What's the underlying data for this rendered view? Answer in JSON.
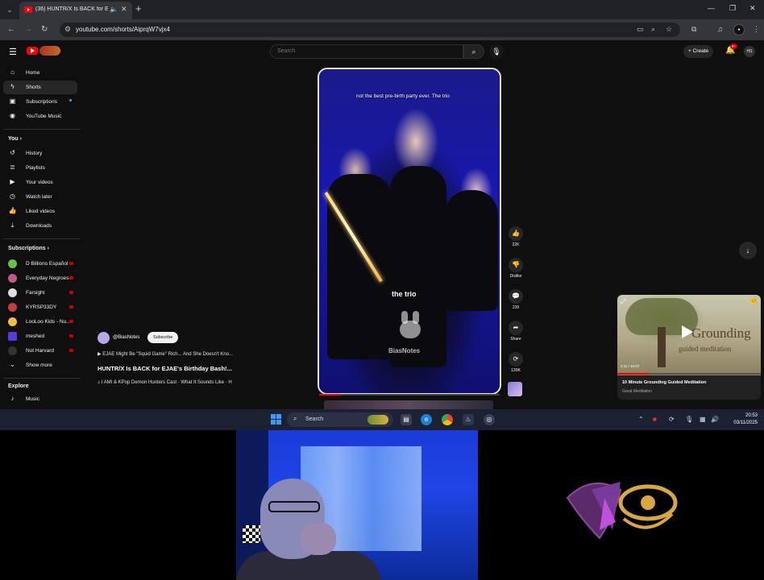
{
  "browser": {
    "tab_title": "(36) HUNTR/X Is BACK for EJAE",
    "url": "youtube.com/shorts/AiprqW7vjx4"
  },
  "youtube": {
    "search_placeholder": "Search",
    "create_label": "Create",
    "notification_count": "9+",
    "profile_initials": "HS"
  },
  "sidebar": {
    "main_items": [
      {
        "label": "Home",
        "icon": "home-icon"
      },
      {
        "label": "Shorts",
        "icon": "shorts-icon"
      },
      {
        "label": "Subscriptions",
        "icon": "subscriptions-icon"
      },
      {
        "label": "YouTube Music",
        "icon": "youtube-music-icon"
      }
    ],
    "you_heading": "You",
    "you_items": [
      {
        "label": "History",
        "icon": "history-icon"
      },
      {
        "label": "Playlists",
        "icon": "playlists-icon"
      },
      {
        "label": "Your videos",
        "icon": "your-videos-icon"
      },
      {
        "label": "Watch later",
        "icon": "watch-later-icon"
      },
      {
        "label": "Liked videos",
        "icon": "liked-videos-icon"
      },
      {
        "label": "Downloads",
        "icon": "downloads-icon"
      }
    ],
    "subscriptions_heading": "Subscriptions",
    "subscriptions": [
      {
        "label": "D Billions Español"
      },
      {
        "label": "Everyday Negroes"
      },
      {
        "label": "Farsight"
      },
      {
        "label": "KYRSP33DY"
      },
      {
        "label": "LooLoo Kids - Nu..."
      },
      {
        "label": "meshed"
      },
      {
        "label": "Not Harvard"
      }
    ],
    "show_more": "Show more",
    "explore_heading": "Explore",
    "explore_items": [
      {
        "label": "Music",
        "icon": "music-icon"
      }
    ]
  },
  "short": {
    "caption_top": "not the best pre-birth party ever. The trio",
    "caption_mid": "the trio",
    "watermark": "BiasNotes",
    "channel": "@BiasNotes",
    "subscribe_label": "Subscribe",
    "desc_line1": "▶ EJAE Might Be \"Squid Game\" Rich... And She Doesn't Kno...",
    "title": "HUNTR/X Is BACK for EJAE's Birthday Bash!...",
    "desc_line2": "♪ I AMI & KPop Demon Hunters Cast · What It Sounds Like · H",
    "progress": 0.12,
    "likes": "22K",
    "dislike_label": "Dislike",
    "comments": "239",
    "share_label": "Share",
    "remix_count": "139K"
  },
  "miniplayer": {
    "thumb_title_line1": "Grounding",
    "thumb_title_line2": "guided meditation",
    "time": "2:11 / 10:07",
    "title": "10 Minute Grounding Guided Meditation",
    "channel": "Great Meditation",
    "progress": 0.22
  },
  "taskbar": {
    "search_label": "Search",
    "time": "20:53",
    "date": "03/11/2025"
  }
}
